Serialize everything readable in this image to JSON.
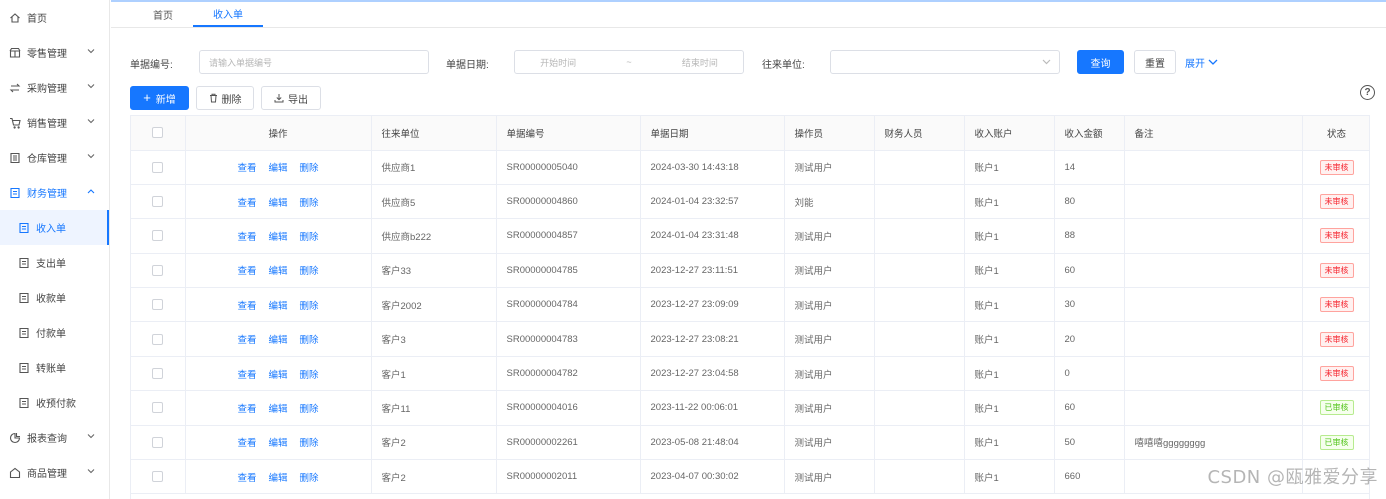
{
  "sidebar": {
    "items": [
      {
        "label": "首页",
        "icon": "home-icon",
        "children": false
      },
      {
        "label": "零售管理",
        "icon": "store-icon",
        "children": true
      },
      {
        "label": "采购管理",
        "icon": "exchange-icon",
        "children": true
      },
      {
        "label": "销售管理",
        "icon": "cart-icon",
        "children": true
      },
      {
        "label": "仓库管理",
        "icon": "warehouse-icon",
        "children": true
      },
      {
        "label": "财务管理",
        "icon": "finance-icon",
        "children": true,
        "open": true
      }
    ],
    "sub_items": [
      {
        "label": "收入单",
        "active": true
      },
      {
        "label": "支出单"
      },
      {
        "label": "收款单"
      },
      {
        "label": "付款单"
      },
      {
        "label": "转账单"
      },
      {
        "label": "收预付款"
      }
    ],
    "bottom_items": [
      {
        "label": "报表查询",
        "icon": "report-icon"
      },
      {
        "label": "商品管理",
        "icon": "product-icon"
      }
    ]
  },
  "tabs": [
    {
      "label": "首页",
      "active": false
    },
    {
      "label": "收入单",
      "active": true
    }
  ],
  "filters": {
    "bill_no_label": "单据编号:",
    "bill_no_placeholder": "请输入单据编号",
    "date_label": "单据日期:",
    "date_start_placeholder": "开始时间",
    "date_sep": "~",
    "date_end_placeholder": "结束时间",
    "partner_label": "往来单位:",
    "query_label": "查询",
    "reset_label": "重置",
    "expand_label": "展开"
  },
  "toolbar": {
    "add_label": "新增",
    "delete_label": "删除",
    "export_label": "导出"
  },
  "table": {
    "headers": [
      "操作",
      "往来单位",
      "单据编号",
      "单据日期",
      "操作员",
      "财务人员",
      "收入账户",
      "收入金额",
      "备注",
      "状态"
    ],
    "ops": [
      "查看",
      "编辑",
      "删除"
    ],
    "rows": [
      {
        "partner": "供应商1",
        "no": "SR00000005040",
        "date": "2024-03-30 14:43:18",
        "operator": "测试用户",
        "finance": "",
        "account": "账户1",
        "amount": "14",
        "remark": "",
        "status": "未审核",
        "status_color": "red"
      },
      {
        "partner": "供应商5",
        "no": "SR00000004860",
        "date": "2024-01-04 23:32:57",
        "operator": "刘能",
        "finance": "",
        "account": "账户1",
        "amount": "80",
        "remark": "",
        "status": "未审核",
        "status_color": "red"
      },
      {
        "partner": "供应商b222",
        "no": "SR00000004857",
        "date": "2024-01-04 23:31:48",
        "operator": "测试用户",
        "finance": "",
        "account": "账户1",
        "amount": "88",
        "remark": "",
        "status": "未审核",
        "status_color": "red"
      },
      {
        "partner": "客户33",
        "no": "SR00000004785",
        "date": "2023-12-27 23:11:51",
        "operator": "测试用户",
        "finance": "",
        "account": "账户1",
        "amount": "60",
        "remark": "",
        "status": "未审核",
        "status_color": "red"
      },
      {
        "partner": "客户2002",
        "no": "SR00000004784",
        "date": "2023-12-27 23:09:09",
        "operator": "测试用户",
        "finance": "",
        "account": "账户1",
        "amount": "30",
        "remark": "",
        "status": "未审核",
        "status_color": "red"
      },
      {
        "partner": "客户3",
        "no": "SR00000004783",
        "date": "2023-12-27 23:08:21",
        "operator": "测试用户",
        "finance": "",
        "account": "账户1",
        "amount": "20",
        "remark": "",
        "status": "未审核",
        "status_color": "red"
      },
      {
        "partner": "客户1",
        "no": "SR00000004782",
        "date": "2023-12-27 23:04:58",
        "operator": "测试用户",
        "finance": "",
        "account": "账户1",
        "amount": "0",
        "remark": "",
        "status": "未审核",
        "status_color": "red"
      },
      {
        "partner": "客户11",
        "no": "SR00000004016",
        "date": "2023-11-22 00:06:01",
        "operator": "测试用户",
        "finance": "",
        "account": "账户1",
        "amount": "60",
        "remark": "",
        "status": "已审核",
        "status_color": "green"
      },
      {
        "partner": "客户2",
        "no": "SR00000002261",
        "date": "2023-05-08 21:48:04",
        "operator": "测试用户",
        "finance": "",
        "account": "账户1",
        "amount": "50",
        "remark": "嘻嘻嘻gggggggg",
        "status": "已审核",
        "status_color": "green"
      },
      {
        "partner": "客户2",
        "no": "SR00000002011",
        "date": "2023-04-07 00:30:02",
        "operator": "测试用户",
        "finance": "",
        "account": "账户1",
        "amount": "660",
        "remark": "",
        "status": "",
        "status_color": "green"
      }
    ]
  },
  "help_glyph": "?",
  "watermark": "CSDN @瓯雅爱分享",
  "colors": {
    "accent": "#1677ff",
    "pending": "#f5222d",
    "approved": "#52c41a"
  }
}
